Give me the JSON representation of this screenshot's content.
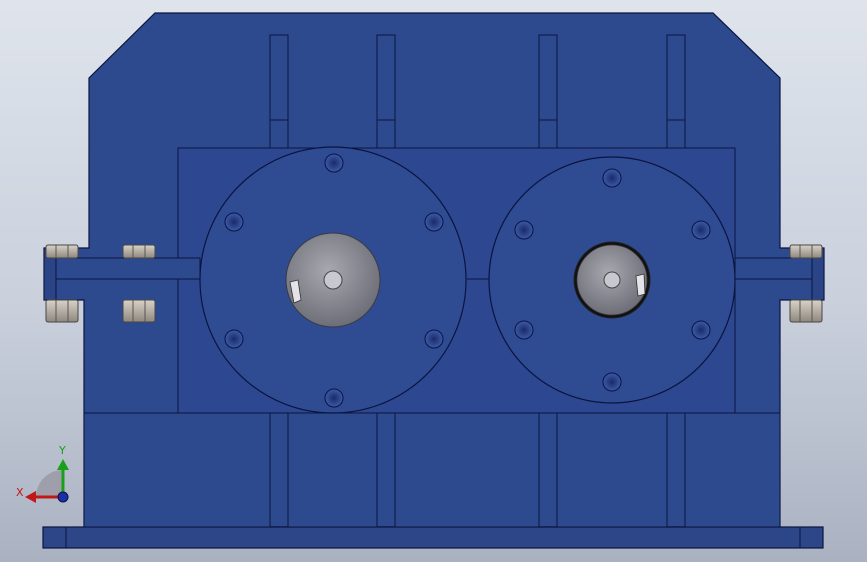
{
  "viewport": {
    "background_top": "#dfe4ec",
    "background_bottom": "#aab2c2"
  },
  "model": {
    "body_color": "#2e4a8e",
    "edge_color": "#0a1440",
    "bearing_color": "#8c8c96",
    "bolt_color": "#b6b0a8"
  },
  "triad": {
    "x_label": "X",
    "y_label": "Y",
    "x_color": "#c01818",
    "y_color": "#18a018",
    "z_color": "#1b2fa8"
  }
}
